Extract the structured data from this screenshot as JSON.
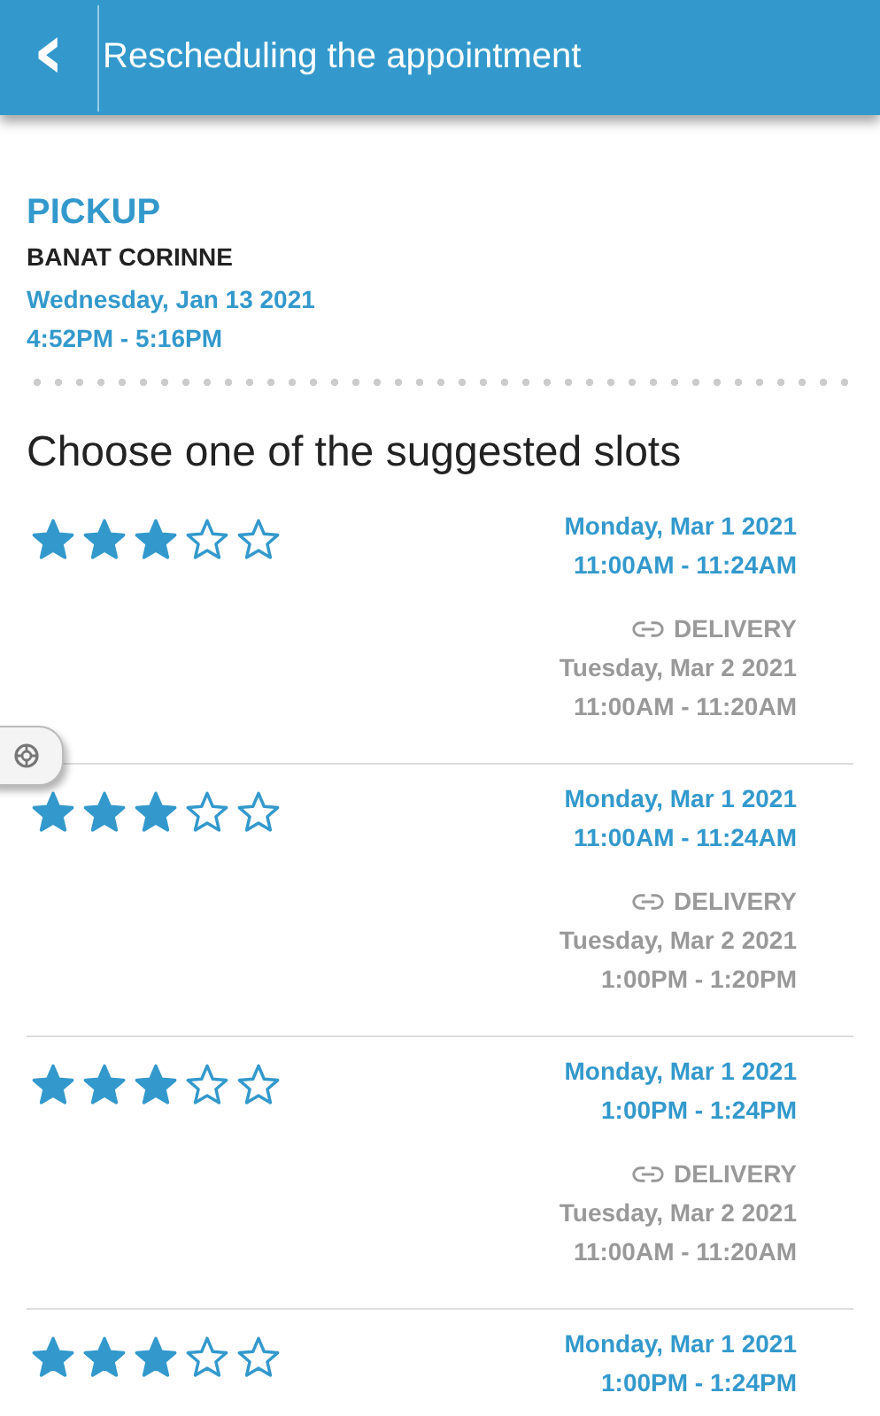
{
  "header": {
    "back_icon": "‹",
    "title": "Rescheduling the appointment"
  },
  "pickup": {
    "heading": "PICKUP",
    "customer": "BANAT CORINNE",
    "date": "Wednesday, Jan 13 2021",
    "time": "4:52PM - 5:16PM"
  },
  "prompt": "Choose one of the suggested slots",
  "slots": [
    {
      "stars": 3,
      "date": "Monday, Mar 1 2021",
      "time": "11:00AM - 11:24AM",
      "delivery": {
        "label": "DELIVERY",
        "date": "Tuesday, Mar 2 2021",
        "time": "11:00AM - 11:20AM"
      }
    },
    {
      "stars": 3,
      "date": "Monday, Mar 1 2021",
      "time": "11:00AM - 11:24AM",
      "delivery": {
        "label": "DELIVERY",
        "date": "Tuesday, Mar 2 2021",
        "time": "1:00PM - 1:20PM"
      }
    },
    {
      "stars": 3,
      "date": "Monday, Mar 1 2021",
      "time": "1:00PM - 1:24PM",
      "delivery": {
        "label": "DELIVERY",
        "date": "Tuesday, Mar 2 2021",
        "time": "11:00AM - 11:20AM"
      }
    },
    {
      "stars": 3,
      "date": "Monday, Mar 1 2021",
      "time": "1:00PM - 1:24PM"
    }
  ]
}
